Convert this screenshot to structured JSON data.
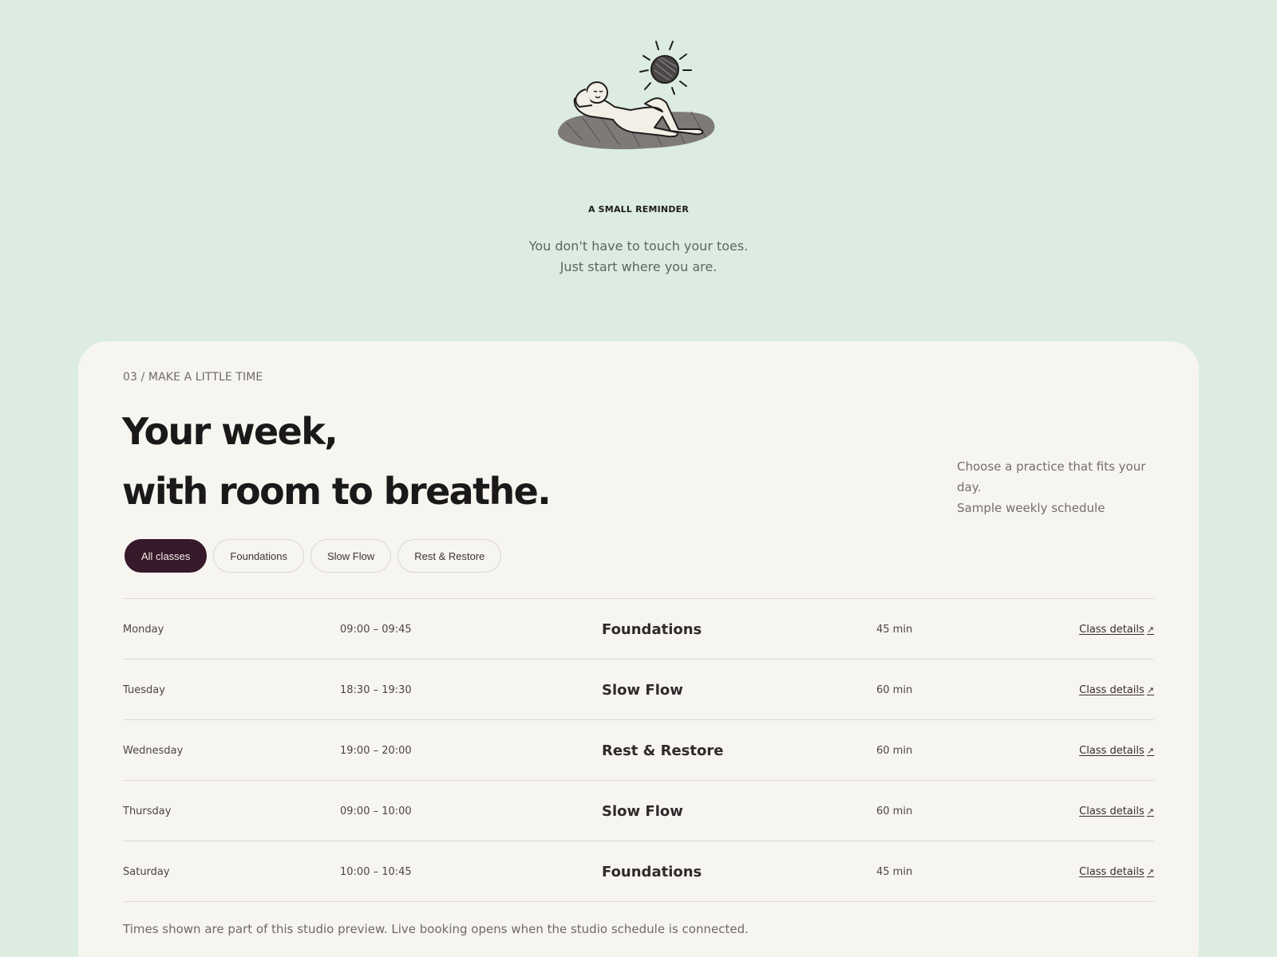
{
  "hero": {
    "eyebrow": "A SMALL REMINDER",
    "message_line1": "You don't have to touch your toes.",
    "message_line2": "Just start where you are."
  },
  "section": {
    "label": "03 / MAKE A LITTLE TIME",
    "heading_line1": "Your week,",
    "heading_line2": "with room to breathe.",
    "note_line1": "Choose a practice that fits your",
    "note_line2": "day.",
    "note_line3": "Sample weekly schedule"
  },
  "filters": [
    {
      "label": "All classes",
      "active": true
    },
    {
      "label": "Foundations",
      "active": false
    },
    {
      "label": "Slow Flow",
      "active": false
    },
    {
      "label": "Rest & Restore",
      "active": false
    }
  ],
  "schedule": [
    {
      "day": "Monday",
      "time": "09:00 – 09:45",
      "class": "Foundations",
      "duration": "45 min",
      "link": "Class details"
    },
    {
      "day": "Tuesday",
      "time": "18:30 – 19:30",
      "class": "Slow Flow",
      "duration": "60 min",
      "link": "Class details"
    },
    {
      "day": "Wednesday",
      "time": "19:00 – 20:00",
      "class": "Rest & Restore",
      "duration": "60 min",
      "link": "Class details"
    },
    {
      "day": "Thursday",
      "time": "09:00 – 10:00",
      "class": "Slow Flow",
      "duration": "60 min",
      "link": "Class details"
    },
    {
      "day": "Saturday",
      "time": "10:00 – 10:45",
      "class": "Foundations",
      "duration": "45 min",
      "link": "Class details"
    }
  ],
  "footnote": "Times shown are part of this studio preview. Live booking opens when the studio schedule is connected.",
  "colors": {
    "page_background": "#dcece1",
    "card_background": "#f6f5f0",
    "accent": "#36192a"
  },
  "icons": {
    "illustration": "person-resting-under-sun-illustration",
    "link_arrow": "arrow-up-right-icon"
  }
}
